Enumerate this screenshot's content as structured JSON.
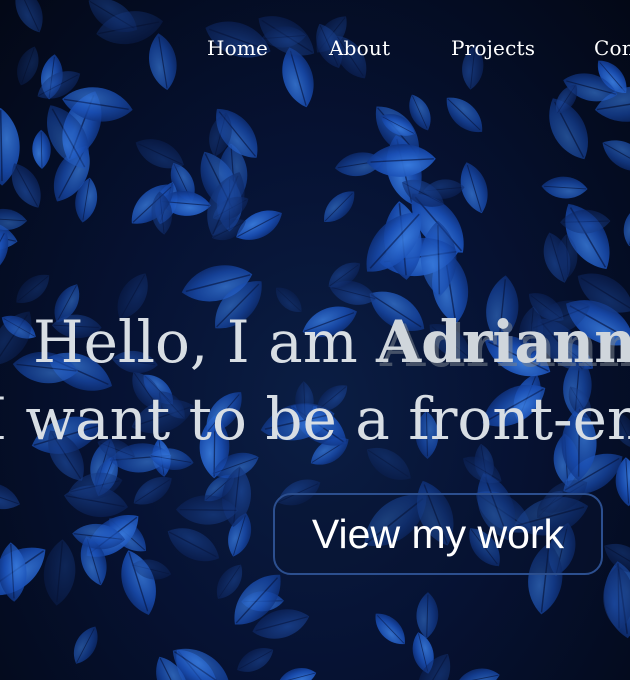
{
  "nav": {
    "items": [
      {
        "label": "Home"
      },
      {
        "label": "About"
      },
      {
        "label": "Projects"
      },
      {
        "label": "Contact"
      }
    ]
  },
  "hero": {
    "greeting": "Hello, I am ",
    "name": "Adrianna",
    "tagline": "I want to be a front-end developer",
    "cta_label": "View my work"
  },
  "background": {
    "description_icon": "leaves-icon",
    "colors": {
      "dark": "#030816",
      "leaf_dark": "#0d2d7a",
      "leaf_mid": "#1a4fb5",
      "leaf_light": "#2e6fd6",
      "text": "#d8dee4",
      "button_border": "#2c4f8f"
    }
  }
}
